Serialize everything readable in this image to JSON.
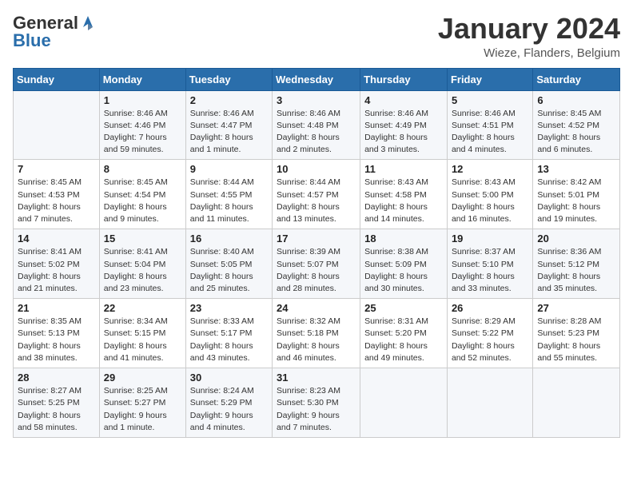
{
  "header": {
    "logo_general": "General",
    "logo_blue": "Blue",
    "month_year": "January 2024",
    "location": "Wieze, Flanders, Belgium"
  },
  "days_of_week": [
    "Sunday",
    "Monday",
    "Tuesday",
    "Wednesday",
    "Thursday",
    "Friday",
    "Saturday"
  ],
  "weeks": [
    [
      {
        "day": "",
        "sunrise": "",
        "sunset": "",
        "daylight": ""
      },
      {
        "day": "1",
        "sunrise": "Sunrise: 8:46 AM",
        "sunset": "Sunset: 4:46 PM",
        "daylight": "Daylight: 7 hours and 59 minutes."
      },
      {
        "day": "2",
        "sunrise": "Sunrise: 8:46 AM",
        "sunset": "Sunset: 4:47 PM",
        "daylight": "Daylight: 8 hours and 1 minute."
      },
      {
        "day": "3",
        "sunrise": "Sunrise: 8:46 AM",
        "sunset": "Sunset: 4:48 PM",
        "daylight": "Daylight: 8 hours and 2 minutes."
      },
      {
        "day": "4",
        "sunrise": "Sunrise: 8:46 AM",
        "sunset": "Sunset: 4:49 PM",
        "daylight": "Daylight: 8 hours and 3 minutes."
      },
      {
        "day": "5",
        "sunrise": "Sunrise: 8:46 AM",
        "sunset": "Sunset: 4:51 PM",
        "daylight": "Daylight: 8 hours and 4 minutes."
      },
      {
        "day": "6",
        "sunrise": "Sunrise: 8:45 AM",
        "sunset": "Sunset: 4:52 PM",
        "daylight": "Daylight: 8 hours and 6 minutes."
      }
    ],
    [
      {
        "day": "7",
        "sunrise": "Sunrise: 8:45 AM",
        "sunset": "Sunset: 4:53 PM",
        "daylight": "Daylight: 8 hours and 7 minutes."
      },
      {
        "day": "8",
        "sunrise": "Sunrise: 8:45 AM",
        "sunset": "Sunset: 4:54 PM",
        "daylight": "Daylight: 8 hours and 9 minutes."
      },
      {
        "day": "9",
        "sunrise": "Sunrise: 8:44 AM",
        "sunset": "Sunset: 4:55 PM",
        "daylight": "Daylight: 8 hours and 11 minutes."
      },
      {
        "day": "10",
        "sunrise": "Sunrise: 8:44 AM",
        "sunset": "Sunset: 4:57 PM",
        "daylight": "Daylight: 8 hours and 13 minutes."
      },
      {
        "day": "11",
        "sunrise": "Sunrise: 8:43 AM",
        "sunset": "Sunset: 4:58 PM",
        "daylight": "Daylight: 8 hours and 14 minutes."
      },
      {
        "day": "12",
        "sunrise": "Sunrise: 8:43 AM",
        "sunset": "Sunset: 5:00 PM",
        "daylight": "Daylight: 8 hours and 16 minutes."
      },
      {
        "day": "13",
        "sunrise": "Sunrise: 8:42 AM",
        "sunset": "Sunset: 5:01 PM",
        "daylight": "Daylight: 8 hours and 19 minutes."
      }
    ],
    [
      {
        "day": "14",
        "sunrise": "Sunrise: 8:41 AM",
        "sunset": "Sunset: 5:02 PM",
        "daylight": "Daylight: 8 hours and 21 minutes."
      },
      {
        "day": "15",
        "sunrise": "Sunrise: 8:41 AM",
        "sunset": "Sunset: 5:04 PM",
        "daylight": "Daylight: 8 hours and 23 minutes."
      },
      {
        "day": "16",
        "sunrise": "Sunrise: 8:40 AM",
        "sunset": "Sunset: 5:05 PM",
        "daylight": "Daylight: 8 hours and 25 minutes."
      },
      {
        "day": "17",
        "sunrise": "Sunrise: 8:39 AM",
        "sunset": "Sunset: 5:07 PM",
        "daylight": "Daylight: 8 hours and 28 minutes."
      },
      {
        "day": "18",
        "sunrise": "Sunrise: 8:38 AM",
        "sunset": "Sunset: 5:09 PM",
        "daylight": "Daylight: 8 hours and 30 minutes."
      },
      {
        "day": "19",
        "sunrise": "Sunrise: 8:37 AM",
        "sunset": "Sunset: 5:10 PM",
        "daylight": "Daylight: 8 hours and 33 minutes."
      },
      {
        "day": "20",
        "sunrise": "Sunrise: 8:36 AM",
        "sunset": "Sunset: 5:12 PM",
        "daylight": "Daylight: 8 hours and 35 minutes."
      }
    ],
    [
      {
        "day": "21",
        "sunrise": "Sunrise: 8:35 AM",
        "sunset": "Sunset: 5:13 PM",
        "daylight": "Daylight: 8 hours and 38 minutes."
      },
      {
        "day": "22",
        "sunrise": "Sunrise: 8:34 AM",
        "sunset": "Sunset: 5:15 PM",
        "daylight": "Daylight: 8 hours and 41 minutes."
      },
      {
        "day": "23",
        "sunrise": "Sunrise: 8:33 AM",
        "sunset": "Sunset: 5:17 PM",
        "daylight": "Daylight: 8 hours and 43 minutes."
      },
      {
        "day": "24",
        "sunrise": "Sunrise: 8:32 AM",
        "sunset": "Sunset: 5:18 PM",
        "daylight": "Daylight: 8 hours and 46 minutes."
      },
      {
        "day": "25",
        "sunrise": "Sunrise: 8:31 AM",
        "sunset": "Sunset: 5:20 PM",
        "daylight": "Daylight: 8 hours and 49 minutes."
      },
      {
        "day": "26",
        "sunrise": "Sunrise: 8:29 AM",
        "sunset": "Sunset: 5:22 PM",
        "daylight": "Daylight: 8 hours and 52 minutes."
      },
      {
        "day": "27",
        "sunrise": "Sunrise: 8:28 AM",
        "sunset": "Sunset: 5:23 PM",
        "daylight": "Daylight: 8 hours and 55 minutes."
      }
    ],
    [
      {
        "day": "28",
        "sunrise": "Sunrise: 8:27 AM",
        "sunset": "Sunset: 5:25 PM",
        "daylight": "Daylight: 8 hours and 58 minutes."
      },
      {
        "day": "29",
        "sunrise": "Sunrise: 8:25 AM",
        "sunset": "Sunset: 5:27 PM",
        "daylight": "Daylight: 9 hours and 1 minute."
      },
      {
        "day": "30",
        "sunrise": "Sunrise: 8:24 AM",
        "sunset": "Sunset: 5:29 PM",
        "daylight": "Daylight: 9 hours and 4 minutes."
      },
      {
        "day": "31",
        "sunrise": "Sunrise: 8:23 AM",
        "sunset": "Sunset: 5:30 PM",
        "daylight": "Daylight: 9 hours and 7 minutes."
      },
      {
        "day": "",
        "sunrise": "",
        "sunset": "",
        "daylight": ""
      },
      {
        "day": "",
        "sunrise": "",
        "sunset": "",
        "daylight": ""
      },
      {
        "day": "",
        "sunrise": "",
        "sunset": "",
        "daylight": ""
      }
    ]
  ]
}
